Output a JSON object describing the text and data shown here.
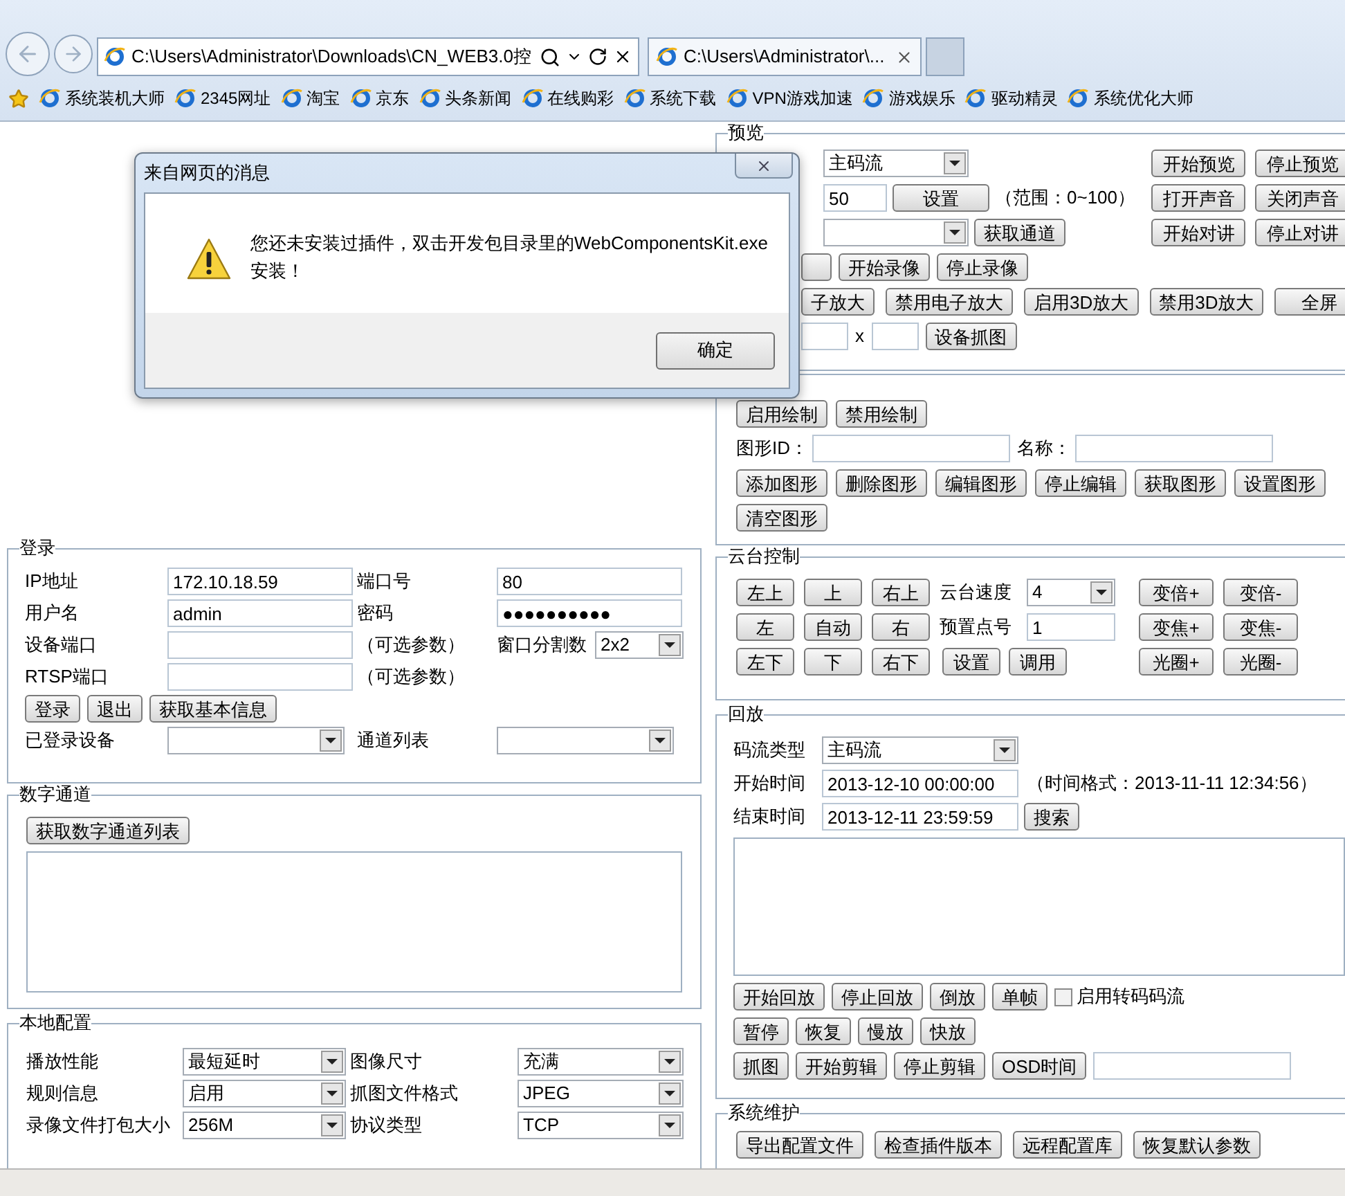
{
  "browser": {
    "address": "C:\\Users\\Administrator\\Downloads\\CN_WEB3.0控",
    "tab": "C:\\Users\\Administrator\\...",
    "favorites": [
      "系统装机大师",
      "2345网址",
      "淘宝",
      "京东",
      "头条新闻",
      "在线购彩",
      "系统下载",
      "VPN游戏加速",
      "游戏娱乐",
      "驱动精灵",
      "系统优化大师"
    ]
  },
  "dialog": {
    "title": "来自网页的消息",
    "message": "您还未安装过插件，双击开发包目录里的WebComponentsKit.exe安装！",
    "ok": "确定"
  },
  "preview": {
    "title": "预览",
    "stream": "主码流",
    "volume": "50",
    "set": "设置",
    "range": "（范围：0~100）",
    "get_channel": "获取通道",
    "right_buttons": [
      [
        "开始预览",
        "停止预览"
      ],
      [
        "打开声音",
        "关闭声音"
      ],
      [
        "开始对讲",
        "停止对讲"
      ]
    ],
    "record_buttons": [
      "开始录像",
      "停止录像"
    ],
    "zoom_buttons": [
      "子放大",
      "禁用电子放大",
      "启用3D放大",
      "禁用3D放大",
      "全屏"
    ],
    "x": "x",
    "capture": "设备抓图"
  },
  "drawing": {
    "toggle_buttons": [
      "启用绘制",
      "禁用绘制"
    ],
    "id_label": "图形ID：",
    "name_label": "名称：",
    "shape_buttons": [
      "添加图形",
      "删除图形",
      "编辑图形",
      "停止编辑",
      "获取图形",
      "设置图形"
    ],
    "clear": "清空图形"
  },
  "login": {
    "title": "登录",
    "ip_label": "IP地址",
    "ip": "172.10.18.59",
    "port_label": "端口号",
    "port": "80",
    "user_label": "用户名",
    "user": "admin",
    "password_label": "密码",
    "password": "●●●●●●●●●●",
    "device_port_label": "设备端口",
    "optional_1": "（可选参数）",
    "split_label": "窗口分割数",
    "split": "2x2",
    "rtsp_label": "RTSP端口",
    "optional_2": "（可选参数）",
    "buttons": [
      "登录",
      "退出",
      "获取基本信息"
    ],
    "logged_label": "已登录设备",
    "channel_label": "通道列表"
  },
  "ptz": {
    "title": "云台控制",
    "direction_buttons": [
      "左上",
      "上",
      "右上",
      "左",
      "自动",
      "右",
      "左下",
      "下",
      "右下"
    ],
    "speed_label": "云台速度",
    "speed": "4",
    "preset_label": "预置点号",
    "preset": "1",
    "preset_buttons": [
      "设置",
      "调用"
    ],
    "lens_buttons": [
      [
        "变倍+",
        "变倍-"
      ],
      [
        "变焦+",
        "变焦-"
      ],
      [
        "光圈+",
        "光圈-"
      ]
    ]
  },
  "digital": {
    "title": "数字通道",
    "button": "获取数字通道列表"
  },
  "playback": {
    "title": "回放",
    "stream_label": "码流类型",
    "stream": "主码流",
    "start_label": "开始时间",
    "start": "2013-12-10 00:00:00",
    "format_hint": "（时间格式：2013-11-11 12:34:56）",
    "end_label": "结束时间",
    "end": "2013-12-11 23:59:59",
    "search": "搜索",
    "button_rows": [
      [
        "开始回放",
        "停止回放",
        "倒放",
        "单帧"
      ],
      [
        "暂停",
        "恢复",
        "慢放",
        "快放"
      ],
      [
        "抓图",
        "开始剪辑",
        "停止剪辑",
        "OSD时间"
      ]
    ],
    "transcode": {
      "label": "启用转码码流",
      "checked": false
    }
  },
  "local": {
    "title": "本地配置",
    "rows": [
      [
        {
          "label": "播放性能",
          "value": "最短延时"
        },
        {
          "label": "图像尺寸",
          "value": "充满"
        }
      ],
      [
        {
          "label": "规则信息",
          "value": "启用"
        },
        {
          "label": "抓图文件格式",
          "value": "JPEG"
        }
      ],
      [
        {
          "label": "录像文件打包大小",
          "value": "256M"
        },
        {
          "label": "协议类型",
          "value": "TCP"
        }
      ]
    ]
  },
  "maintenance": {
    "title": "系统维护",
    "buttons": [
      "导出配置文件",
      "检查插件版本",
      "远程配置库",
      "恢复默认参数"
    ]
  }
}
